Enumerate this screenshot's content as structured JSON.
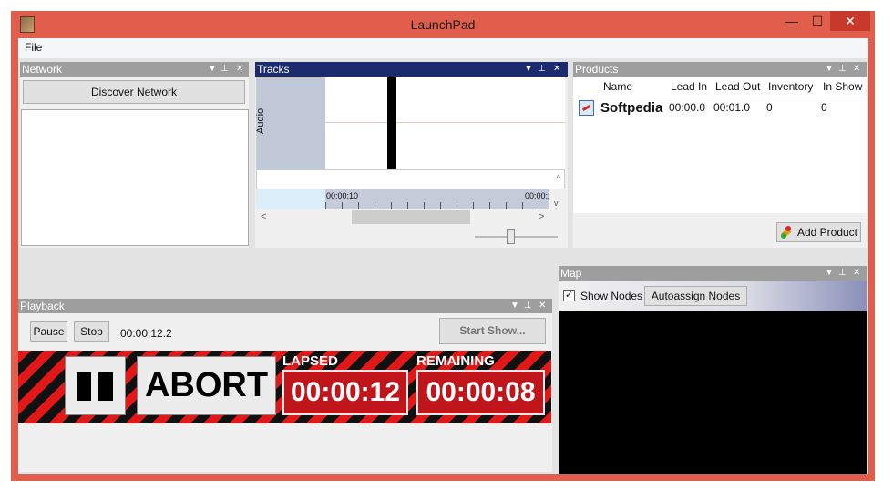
{
  "window": {
    "title": "LaunchPad",
    "controls": {
      "minimize": "—",
      "maximize": "☐",
      "close": "✕"
    }
  },
  "menu": {
    "file": "File"
  },
  "network": {
    "header": "Network",
    "discover_button": "Discover Network"
  },
  "tracks": {
    "header": "Tracks",
    "track_label": "Audio",
    "ruler_start": "00:00:10",
    "ruler_end": "00:00:2",
    "scroll_left": "<",
    "scroll_right": ">",
    "scroll_up": "^",
    "scroll_down": "v"
  },
  "products": {
    "header": "Products",
    "columns": [
      "Name",
      "Lead In",
      "Lead Out",
      "Inventory",
      "In Show"
    ],
    "rows": [
      {
        "name": "Softpedia",
        "lead_in": "00:00.0",
        "lead_out": "00:01.0",
        "inventory": "0",
        "in_show": "0"
      }
    ],
    "add_button": "Add Product"
  },
  "map": {
    "header": "Map",
    "show_nodes_label": "Show Nodes",
    "show_nodes_checked": true,
    "autoassign_button": "Autoassign Nodes"
  },
  "playback": {
    "header": "Playback",
    "pause_button": "Pause",
    "stop_button": "Stop",
    "elapsed_time": "00:00:12.2",
    "start_show_button": "Start Show...",
    "abort_button": "ABORT",
    "lapsed_label": "LAPSED",
    "remaining_label": "REMAINING",
    "lapsed_time": "00:00:12",
    "remaining_time": "00:00:08"
  },
  "panel_controls": {
    "dropdown": "▼",
    "pin": "⊥",
    "close": "✕"
  },
  "colors": {
    "window_frame": "#e05e4b",
    "active_header": "#1c2b6e",
    "inactive_header": "#9e9e9e",
    "alert_red": "#c0151b"
  }
}
